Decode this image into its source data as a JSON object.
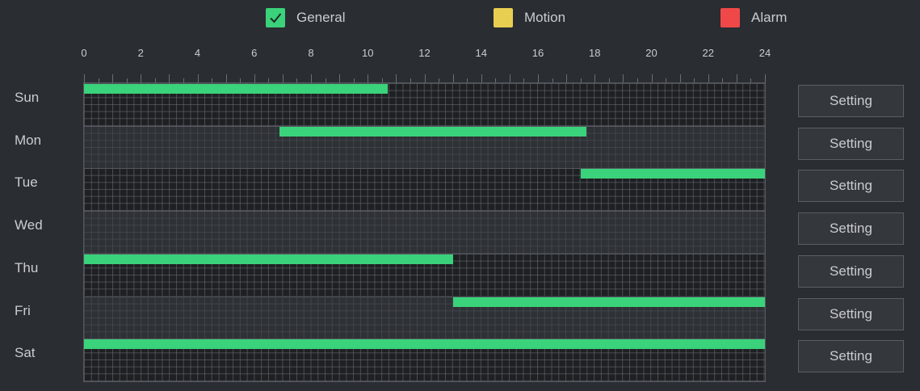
{
  "legend": [
    {
      "id": "general",
      "label": "General",
      "color": "#3ad27a",
      "checked": true
    },
    {
      "id": "motion",
      "label": "Motion",
      "color": "#e8cf52",
      "checked": false
    },
    {
      "id": "alarm",
      "label": "Alarm",
      "color": "#f04848",
      "checked": false
    }
  ],
  "hour_ticks": [
    "0",
    "2",
    "4",
    "6",
    "8",
    "10",
    "12",
    "14",
    "16",
    "18",
    "20",
    "22",
    "24"
  ],
  "days": [
    {
      "label": "Sun",
      "segments": [
        {
          "start": 0,
          "end": 10.7
        }
      ],
      "button": "Setting"
    },
    {
      "label": "Mon",
      "segments": [
        {
          "start": 6.9,
          "end": 17.7
        }
      ],
      "button": "Setting"
    },
    {
      "label": "Tue",
      "segments": [
        {
          "start": 17.5,
          "end": 24
        }
      ],
      "button": "Setting"
    },
    {
      "label": "Wed",
      "segments": [],
      "button": "Setting"
    },
    {
      "label": "Thu",
      "segments": [
        {
          "start": 0,
          "end": 13
        }
      ],
      "button": "Setting"
    },
    {
      "label": "Fri",
      "segments": [
        {
          "start": 13,
          "end": 24
        }
      ],
      "button": "Setting"
    },
    {
      "label": "Sat",
      "segments": [
        {
          "start": 0,
          "end": 24
        }
      ],
      "button": "Setting"
    }
  ]
}
